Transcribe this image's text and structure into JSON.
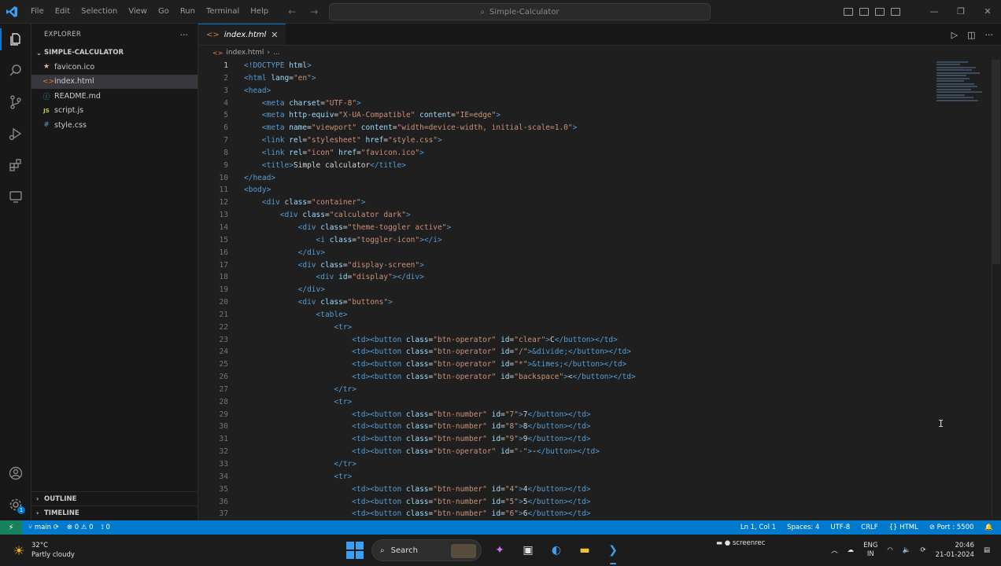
{
  "window": {
    "title": "Simple-Calculator",
    "menu": [
      "File",
      "Edit",
      "Selection",
      "View",
      "Go",
      "Run",
      "Terminal",
      "Help"
    ]
  },
  "sidebar": {
    "title": "EXPLORER",
    "folder": "SIMPLE-CALCULATOR",
    "files": [
      {
        "name": "favicon.ico",
        "icon": "star-icon",
        "color": "#e5c07b"
      },
      {
        "name": "index.html",
        "icon": "html-icon",
        "color": "#e37933"
      },
      {
        "name": "README.md",
        "icon": "info-icon",
        "color": "#519aba"
      },
      {
        "name": "script.js",
        "icon": "js-icon",
        "color": "#cbcb41"
      },
      {
        "name": "style.css",
        "icon": "css-icon",
        "color": "#519aba"
      }
    ],
    "outline": "OUTLINE",
    "timeline": "TIMELINE"
  },
  "editor": {
    "tab": "index.html",
    "breadcrumb": [
      "index.html",
      "..."
    ],
    "lines": [
      {
        "n": "1",
        "i": 0,
        "t": [
          [
            "tg",
            "<!DOCTYPE "
          ],
          [
            "at",
            "html"
          ],
          [
            "tg",
            ">"
          ]
        ]
      },
      {
        "n": "2",
        "i": 0,
        "t": [
          [
            "tg",
            "<html "
          ],
          [
            "at",
            "lang"
          ],
          [
            "tx",
            "="
          ],
          [
            "st",
            "\"en\""
          ],
          [
            "tg",
            ">"
          ]
        ]
      },
      {
        "n": "3",
        "i": 0,
        "t": [
          [
            "tg",
            "<head>"
          ]
        ]
      },
      {
        "n": "4",
        "i": 1,
        "t": [
          [
            "tg",
            "<meta "
          ],
          [
            "at",
            "charset"
          ],
          [
            "tx",
            "="
          ],
          [
            "st",
            "\"UTF-8\""
          ],
          [
            "tg",
            ">"
          ]
        ]
      },
      {
        "n": "5",
        "i": 1,
        "t": [
          [
            "tg",
            "<meta "
          ],
          [
            "at",
            "http-equiv"
          ],
          [
            "tx",
            "="
          ],
          [
            "st",
            "\"X-UA-Compatible\" "
          ],
          [
            "at",
            "content"
          ],
          [
            "tx",
            "="
          ],
          [
            "st",
            "\"IE=edge\""
          ],
          [
            "tg",
            ">"
          ]
        ]
      },
      {
        "n": "6",
        "i": 1,
        "t": [
          [
            "tg",
            "<meta "
          ],
          [
            "at",
            "name"
          ],
          [
            "tx",
            "="
          ],
          [
            "st",
            "\"viewport\" "
          ],
          [
            "at",
            "content"
          ],
          [
            "tx",
            "="
          ],
          [
            "st",
            "\"width=device-width, initial-scale=1.0\""
          ],
          [
            "tg",
            ">"
          ]
        ]
      },
      {
        "n": "7",
        "i": 1,
        "t": [
          [
            "tg",
            "<link "
          ],
          [
            "at",
            "rel"
          ],
          [
            "tx",
            "="
          ],
          [
            "st",
            "\"stylesheet\" "
          ],
          [
            "at",
            "href"
          ],
          [
            "tx",
            "="
          ],
          [
            "st",
            "\"style.css\""
          ],
          [
            "tg",
            ">"
          ]
        ]
      },
      {
        "n": "8",
        "i": 1,
        "t": [
          [
            "tg",
            "<link "
          ],
          [
            "at",
            "rel"
          ],
          [
            "tx",
            "="
          ],
          [
            "st",
            "\"icon\" "
          ],
          [
            "at",
            "href"
          ],
          [
            "tx",
            "="
          ],
          [
            "st",
            "\"favicon.ico\""
          ],
          [
            "tg",
            ">"
          ]
        ]
      },
      {
        "n": "9",
        "i": 1,
        "t": [
          [
            "tg",
            "<title>"
          ],
          [
            "tx",
            "Simple calculator"
          ],
          [
            "tg",
            "</title>"
          ]
        ]
      },
      {
        "n": "10",
        "i": 0,
        "t": [
          [
            "tg",
            "</head>"
          ]
        ]
      },
      {
        "n": "11",
        "i": 0,
        "t": [
          [
            "tg",
            "<body>"
          ]
        ]
      },
      {
        "n": "12",
        "i": 1,
        "t": [
          [
            "tg",
            "<div "
          ],
          [
            "at",
            "class"
          ],
          [
            "tx",
            "="
          ],
          [
            "st",
            "\"container\""
          ],
          [
            "tg",
            ">"
          ]
        ]
      },
      {
        "n": "13",
        "i": 2,
        "t": [
          [
            "tg",
            "<div "
          ],
          [
            "at",
            "class"
          ],
          [
            "tx",
            "="
          ],
          [
            "st",
            "\"calculator dark\""
          ],
          [
            "tg",
            ">"
          ]
        ]
      },
      {
        "n": "14",
        "i": 3,
        "t": [
          [
            "tg",
            "<div "
          ],
          [
            "at",
            "class"
          ],
          [
            "tx",
            "="
          ],
          [
            "st",
            "\"theme-toggler active\""
          ],
          [
            "tg",
            ">"
          ]
        ]
      },
      {
        "n": "15",
        "i": 4,
        "t": [
          [
            "tg",
            "<i "
          ],
          [
            "at",
            "class"
          ],
          [
            "tx",
            "="
          ],
          [
            "st",
            "\"toggler-icon\""
          ],
          [
            "tg",
            "></i>"
          ]
        ]
      },
      {
        "n": "16",
        "i": 3,
        "t": [
          [
            "tg",
            "</div>"
          ]
        ]
      },
      {
        "n": "17",
        "i": 3,
        "t": [
          [
            "tg",
            "<div "
          ],
          [
            "at",
            "class"
          ],
          [
            "tx",
            "="
          ],
          [
            "st",
            "\"display-screen\""
          ],
          [
            "tg",
            ">"
          ]
        ]
      },
      {
        "n": "18",
        "i": 4,
        "t": [
          [
            "tg",
            "<div "
          ],
          [
            "at",
            "id"
          ],
          [
            "tx",
            "="
          ],
          [
            "st",
            "\"display\""
          ],
          [
            "tg",
            "></div>"
          ]
        ]
      },
      {
        "n": "19",
        "i": 3,
        "t": [
          [
            "tg",
            "</div>"
          ]
        ]
      },
      {
        "n": "20",
        "i": 3,
        "t": [
          [
            "tg",
            "<div "
          ],
          [
            "at",
            "class"
          ],
          [
            "tx",
            "="
          ],
          [
            "st",
            "\"buttons\""
          ],
          [
            "tg",
            ">"
          ]
        ]
      },
      {
        "n": "21",
        "i": 4,
        "t": [
          [
            "tg",
            "<table>"
          ]
        ]
      },
      {
        "n": "22",
        "i": 5,
        "t": [
          [
            "tg",
            "<tr>"
          ]
        ]
      },
      {
        "n": "23",
        "i": 6,
        "t": [
          [
            "tg",
            "<td><button "
          ],
          [
            "at",
            "class"
          ],
          [
            "tx",
            "="
          ],
          [
            "st",
            "\"btn-operator\" "
          ],
          [
            "at",
            "id"
          ],
          [
            "tx",
            "="
          ],
          [
            "st",
            "\"clear\""
          ],
          [
            "tg",
            ">"
          ],
          [
            "tx",
            "C"
          ],
          [
            "tg",
            "</button></td>"
          ]
        ]
      },
      {
        "n": "24",
        "i": 6,
        "t": [
          [
            "tg",
            "<td><button "
          ],
          [
            "at",
            "class"
          ],
          [
            "tx",
            "="
          ],
          [
            "st",
            "\"btn-operator\" "
          ],
          [
            "at",
            "id"
          ],
          [
            "tx",
            "="
          ],
          [
            "st",
            "\"/\""
          ],
          [
            "tg",
            ">"
          ],
          [
            "en",
            "&divide;"
          ],
          [
            "tg",
            "</button></td>"
          ]
        ]
      },
      {
        "n": "25",
        "i": 6,
        "t": [
          [
            "tg",
            "<td><button "
          ],
          [
            "at",
            "class"
          ],
          [
            "tx",
            "="
          ],
          [
            "st",
            "\"btn-operator\" "
          ],
          [
            "at",
            "id"
          ],
          [
            "tx",
            "="
          ],
          [
            "st",
            "\"*\""
          ],
          [
            "tg",
            ">"
          ],
          [
            "en",
            "&times;"
          ],
          [
            "tg",
            "</button></td>"
          ]
        ]
      },
      {
        "n": "26",
        "i": 6,
        "t": [
          [
            "tg",
            "<td><button "
          ],
          [
            "at",
            "class"
          ],
          [
            "tx",
            "="
          ],
          [
            "st",
            "\"btn-operator\" "
          ],
          [
            "at",
            "id"
          ],
          [
            "tx",
            "="
          ],
          [
            "st",
            "\"backspace\""
          ],
          [
            "tg",
            ">"
          ],
          [
            "tx",
            "<"
          ],
          [
            "tg",
            "</button></td>"
          ]
        ]
      },
      {
        "n": "27",
        "i": 5,
        "t": [
          [
            "tg",
            "</tr>"
          ]
        ]
      },
      {
        "n": "28",
        "i": 5,
        "t": [
          [
            "tg",
            "<tr>"
          ]
        ]
      },
      {
        "n": "29",
        "i": 6,
        "t": [
          [
            "tg",
            "<td><button "
          ],
          [
            "at",
            "class"
          ],
          [
            "tx",
            "="
          ],
          [
            "st",
            "\"btn-number\" "
          ],
          [
            "at",
            "id"
          ],
          [
            "tx",
            "="
          ],
          [
            "st",
            "\"7\""
          ],
          [
            "tg",
            ">"
          ],
          [
            "tx",
            "7"
          ],
          [
            "tg",
            "</button></td>"
          ]
        ]
      },
      {
        "n": "30",
        "i": 6,
        "t": [
          [
            "tg",
            "<td><button "
          ],
          [
            "at",
            "class"
          ],
          [
            "tx",
            "="
          ],
          [
            "st",
            "\"btn-number\" "
          ],
          [
            "at",
            "id"
          ],
          [
            "tx",
            "="
          ],
          [
            "st",
            "\"8\""
          ],
          [
            "tg",
            ">"
          ],
          [
            "tx",
            "8"
          ],
          [
            "tg",
            "</button></td>"
          ]
        ]
      },
      {
        "n": "31",
        "i": 6,
        "t": [
          [
            "tg",
            "<td><button "
          ],
          [
            "at",
            "class"
          ],
          [
            "tx",
            "="
          ],
          [
            "st",
            "\"btn-number\" "
          ],
          [
            "at",
            "id"
          ],
          [
            "tx",
            "="
          ],
          [
            "st",
            "\"9\""
          ],
          [
            "tg",
            ">"
          ],
          [
            "tx",
            "9"
          ],
          [
            "tg",
            "</button></td>"
          ]
        ]
      },
      {
        "n": "32",
        "i": 6,
        "t": [
          [
            "tg",
            "<td><button "
          ],
          [
            "at",
            "class"
          ],
          [
            "tx",
            "="
          ],
          [
            "st",
            "\"btn-operator\" "
          ],
          [
            "at",
            "id"
          ],
          [
            "tx",
            "="
          ],
          [
            "st",
            "\"-\""
          ],
          [
            "tg",
            ">"
          ],
          [
            "tx",
            "-"
          ],
          [
            "tg",
            "</button></td>"
          ]
        ]
      },
      {
        "n": "33",
        "i": 5,
        "t": [
          [
            "tg",
            "</tr>"
          ]
        ]
      },
      {
        "n": "34",
        "i": 5,
        "t": [
          [
            "tg",
            "<tr>"
          ]
        ]
      },
      {
        "n": "35",
        "i": 6,
        "t": [
          [
            "tg",
            "<td><button "
          ],
          [
            "at",
            "class"
          ],
          [
            "tx",
            "="
          ],
          [
            "st",
            "\"btn-number\" "
          ],
          [
            "at",
            "id"
          ],
          [
            "tx",
            "="
          ],
          [
            "st",
            "\"4\""
          ],
          [
            "tg",
            ">"
          ],
          [
            "tx",
            "4"
          ],
          [
            "tg",
            "</button></td>"
          ]
        ]
      },
      {
        "n": "36",
        "i": 6,
        "t": [
          [
            "tg",
            "<td><button "
          ],
          [
            "at",
            "class"
          ],
          [
            "tx",
            "="
          ],
          [
            "st",
            "\"btn-number\" "
          ],
          [
            "at",
            "id"
          ],
          [
            "tx",
            "="
          ],
          [
            "st",
            "\"5\""
          ],
          [
            "tg",
            ">"
          ],
          [
            "tx",
            "5"
          ],
          [
            "tg",
            "</button></td>"
          ]
        ]
      },
      {
        "n": "37",
        "i": 6,
        "t": [
          [
            "tg",
            "<td><button "
          ],
          [
            "at",
            "class"
          ],
          [
            "tx",
            "="
          ],
          [
            "st",
            "\"btn-number\" "
          ],
          [
            "at",
            "id"
          ],
          [
            "tx",
            "="
          ],
          [
            "st",
            "\"6\""
          ],
          [
            "tg",
            ">"
          ],
          [
            "tx",
            "6"
          ],
          [
            "tg",
            "</button></td>"
          ]
        ]
      }
    ]
  },
  "statusbar": {
    "branch": "main",
    "errors": "0",
    "warnings": "0",
    "ports": "0",
    "position": "Ln 1, Col 1",
    "spaces": "Spaces: 4",
    "encoding": "UTF-8",
    "eol": "CRLF",
    "language": "HTML",
    "port": "Port : 5500"
  },
  "taskbar": {
    "temp": "32°C",
    "weather": "Partly cloudy",
    "search": "Search",
    "recorder": "screenrec",
    "lang1": "ENG",
    "lang2": "IN",
    "time": "20:46",
    "date": "21-01-2024"
  }
}
